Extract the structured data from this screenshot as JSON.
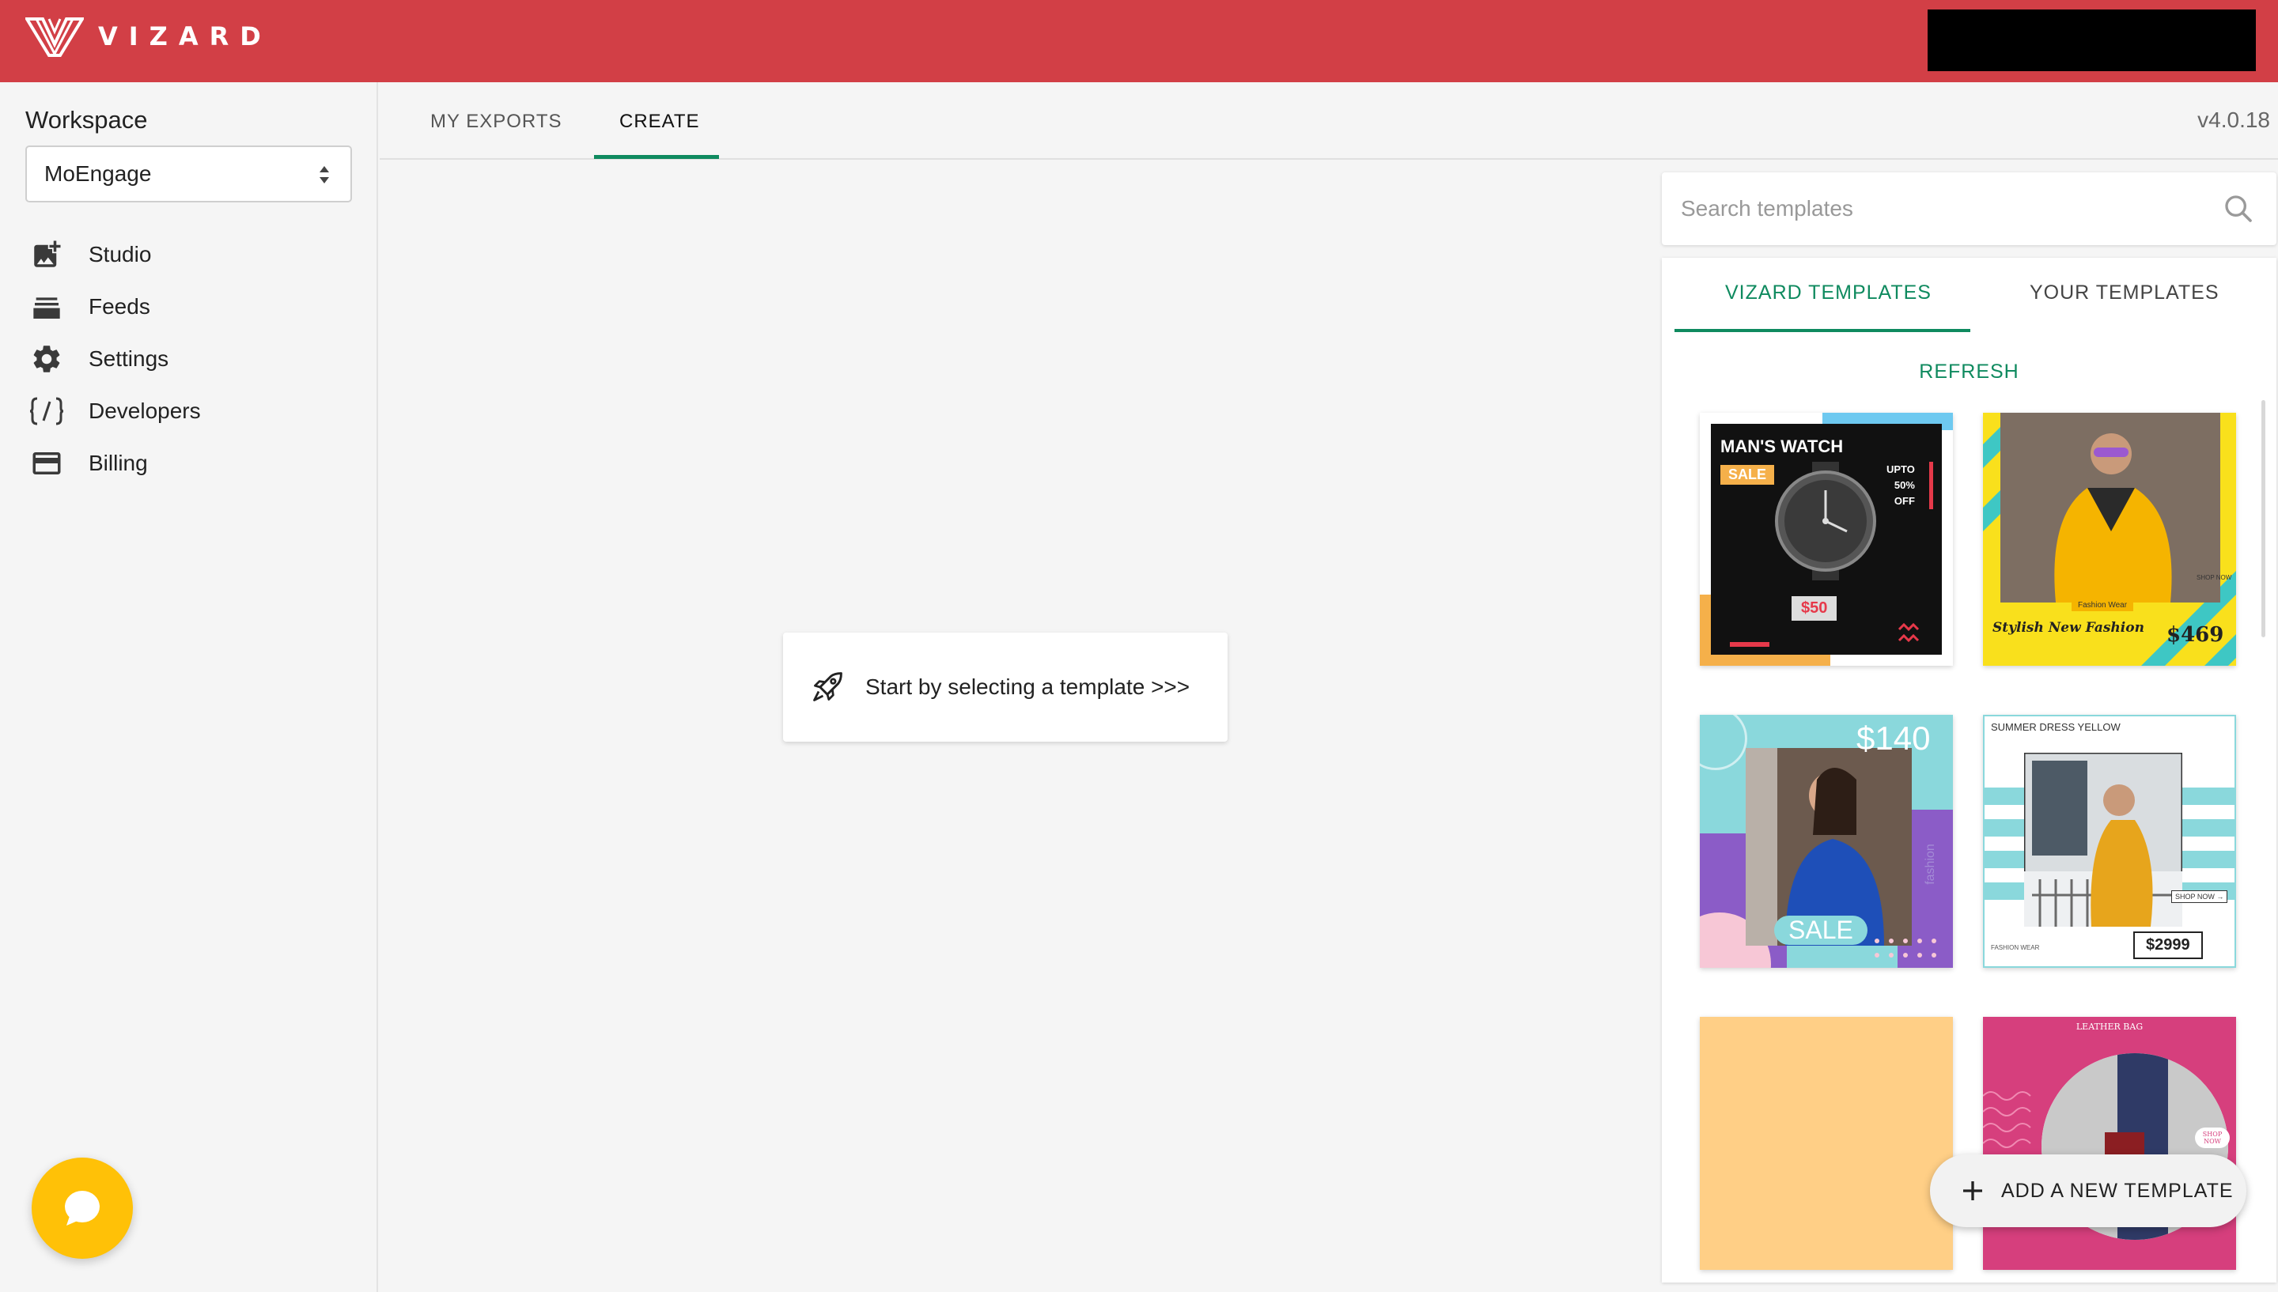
{
  "app": {
    "brand": "VIZARD",
    "accent": "#d23f46",
    "green": "#0f8a5f",
    "version": "v4.0.18"
  },
  "sidebar": {
    "workspace_label": "Workspace",
    "workspace_value": "MoEngage",
    "items": [
      {
        "label": "Studio",
        "icon": "add-photo-icon"
      },
      {
        "label": "Feeds",
        "icon": "stack-icon"
      },
      {
        "label": "Settings",
        "icon": "gear-icon"
      },
      {
        "label": "Developers",
        "icon": "code-icon"
      },
      {
        "label": "Billing",
        "icon": "card-icon"
      }
    ]
  },
  "tabs": {
    "exports": "MY EXPORTS",
    "create": "CREATE"
  },
  "center": {
    "prompt": "Start by selecting a template >>>"
  },
  "search": {
    "placeholder": "Search templates"
  },
  "templates": {
    "tab_vizard": "VIZARD TEMPLATES",
    "tab_yours": "YOUR TEMPLATES",
    "refresh": "REFRESH",
    "watch": {
      "title": "MAN'S WATCH",
      "sale": "SALE",
      "upto": "UPTO",
      "pct": "50%",
      "off": "OFF",
      "price": "$50"
    },
    "fashion": {
      "title": "Stylish New Fashion",
      "price": "$469",
      "tag": "Fashion Wear",
      "shop": "SHOP NOW"
    },
    "sale": {
      "price": "$140",
      "sale": "SALE",
      "side": "fashion"
    },
    "dress": {
      "title": "SUMMER DRESS YELLOW",
      "shop": "SHOP NOW →",
      "wear": "FASHION WEAR",
      "price": "$2999"
    },
    "bag": {
      "title": "LEATHER BAG",
      "shop": "SHOP NOW"
    }
  },
  "add_button": "ADD A NEW TEMPLATE"
}
